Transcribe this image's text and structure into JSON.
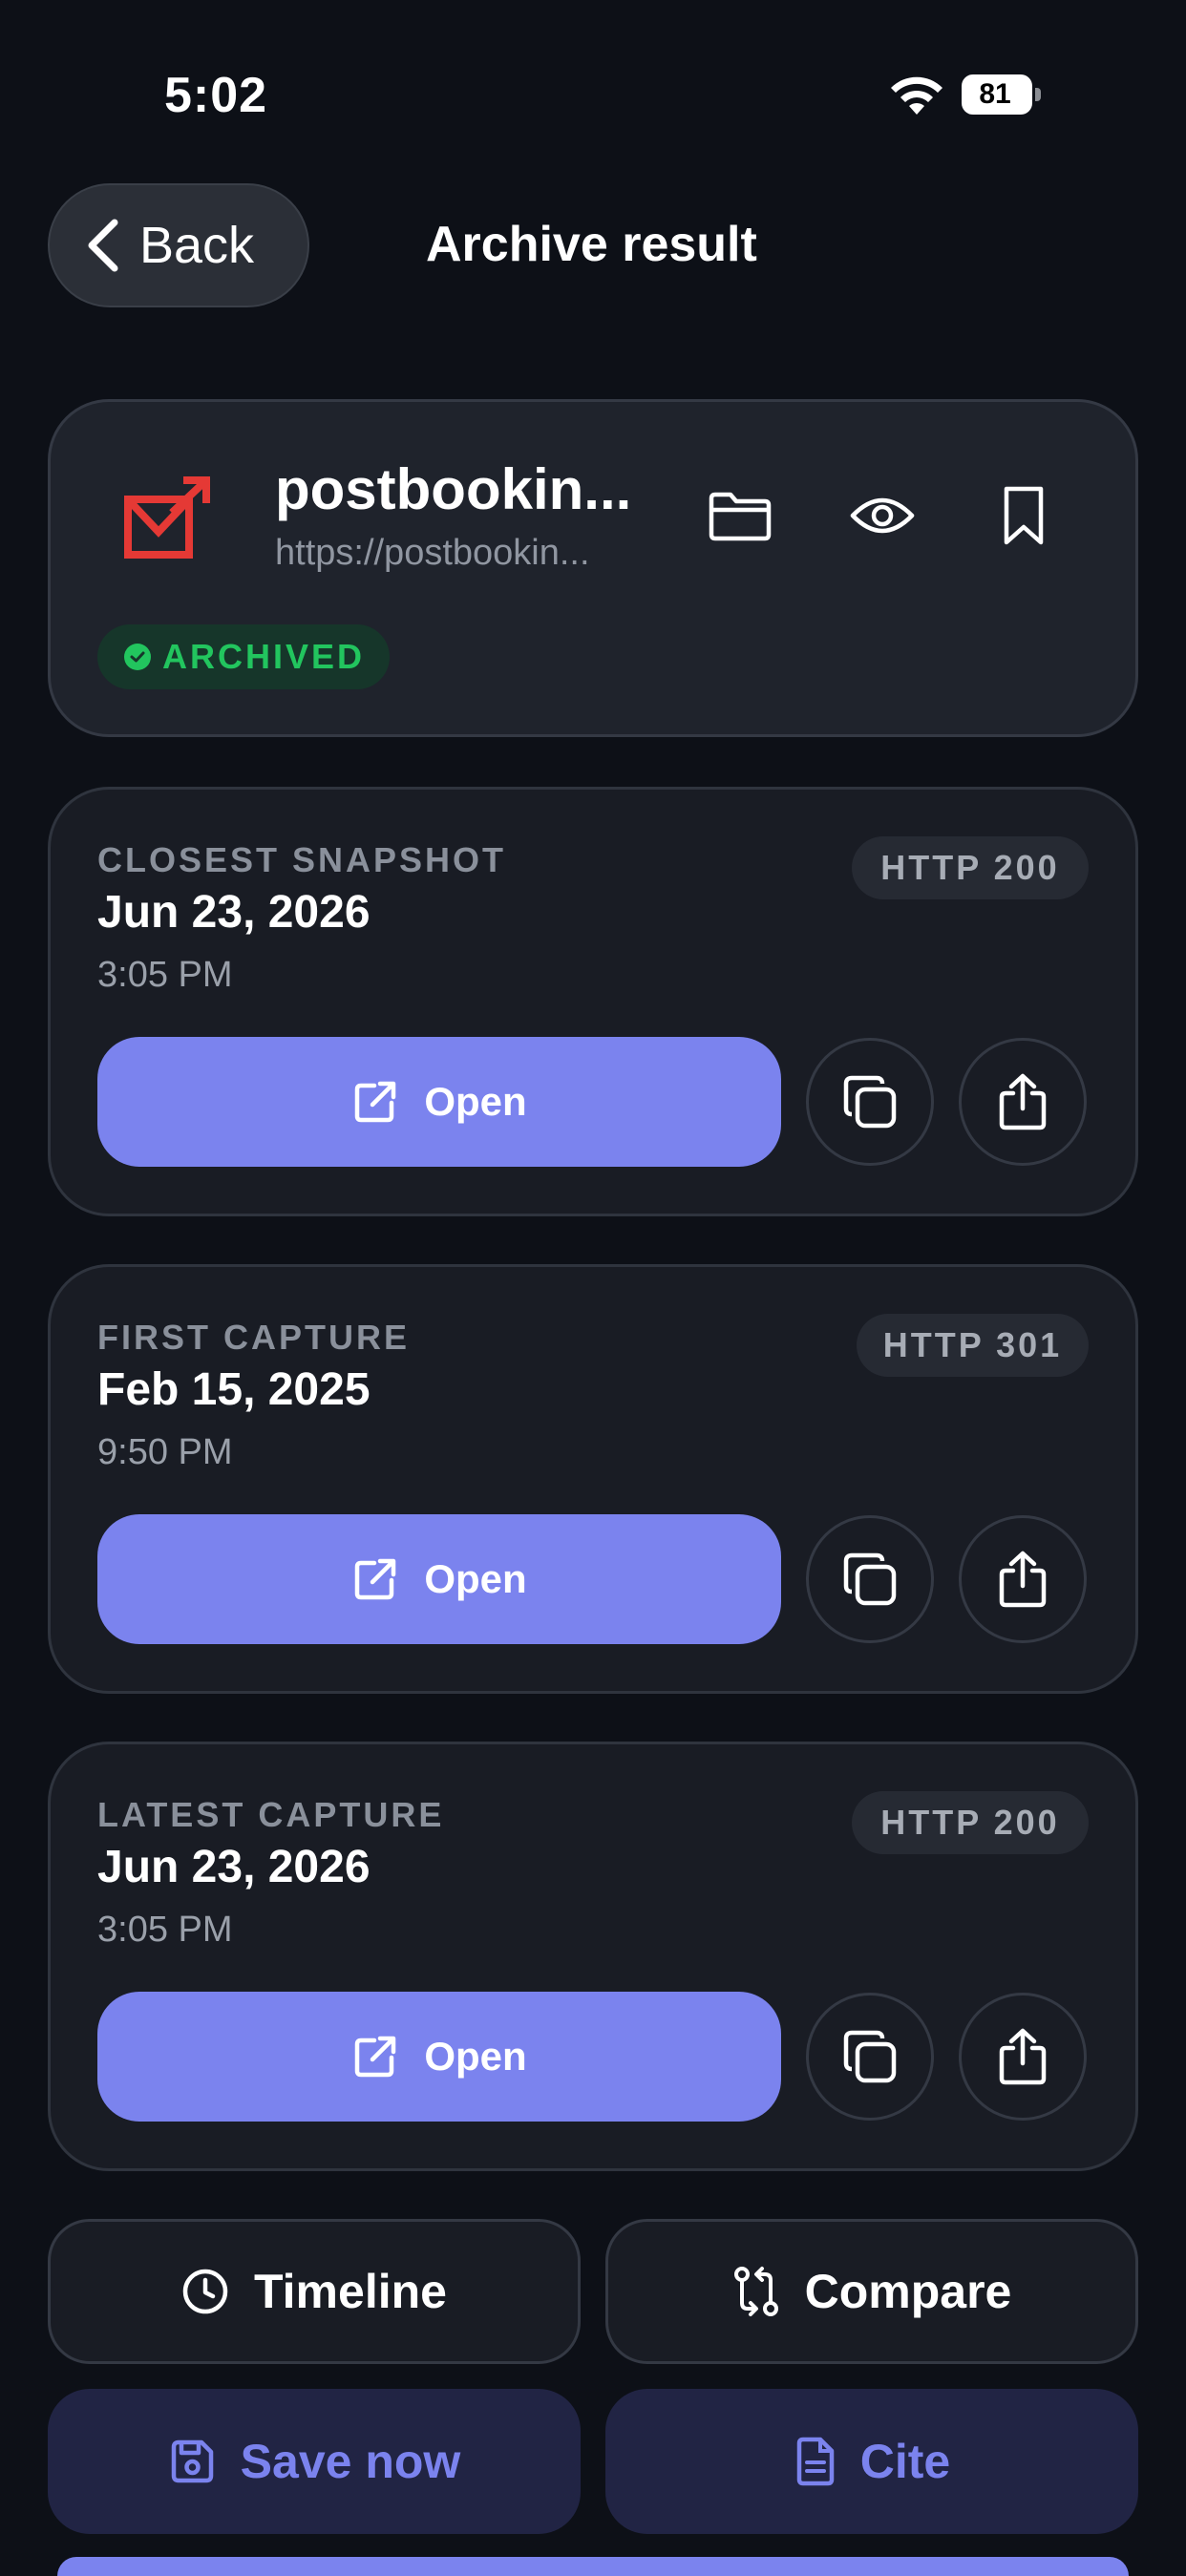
{
  "status_bar": {
    "time": "5:02",
    "battery": "81"
  },
  "header": {
    "back_label": "Back",
    "title": "Archive result"
  },
  "site": {
    "name": "postbookin...",
    "url": "https://postbookin...",
    "status": "ARCHIVED",
    "logo_color": "#e53935"
  },
  "snapshots": [
    {
      "label": "CLOSEST SNAPSHOT",
      "date": "Jun 23, 2026",
      "time": "3:05 PM",
      "http": "HTTP 200",
      "open_label": "Open"
    },
    {
      "label": "FIRST CAPTURE",
      "date": "Feb 15, 2025",
      "time": "9:50 PM",
      "http": "HTTP 301",
      "open_label": "Open"
    },
    {
      "label": "LATEST CAPTURE",
      "date": "Jun 23, 2026",
      "time": "3:05 PM",
      "http": "HTTP 200",
      "open_label": "Open"
    }
  ],
  "actions": {
    "timeline": "Timeline",
    "compare": "Compare",
    "save_now": "Save now",
    "cite": "Cite"
  },
  "colors": {
    "accent": "#7b83ee",
    "success": "#22c55e",
    "background": "#0d1017"
  }
}
